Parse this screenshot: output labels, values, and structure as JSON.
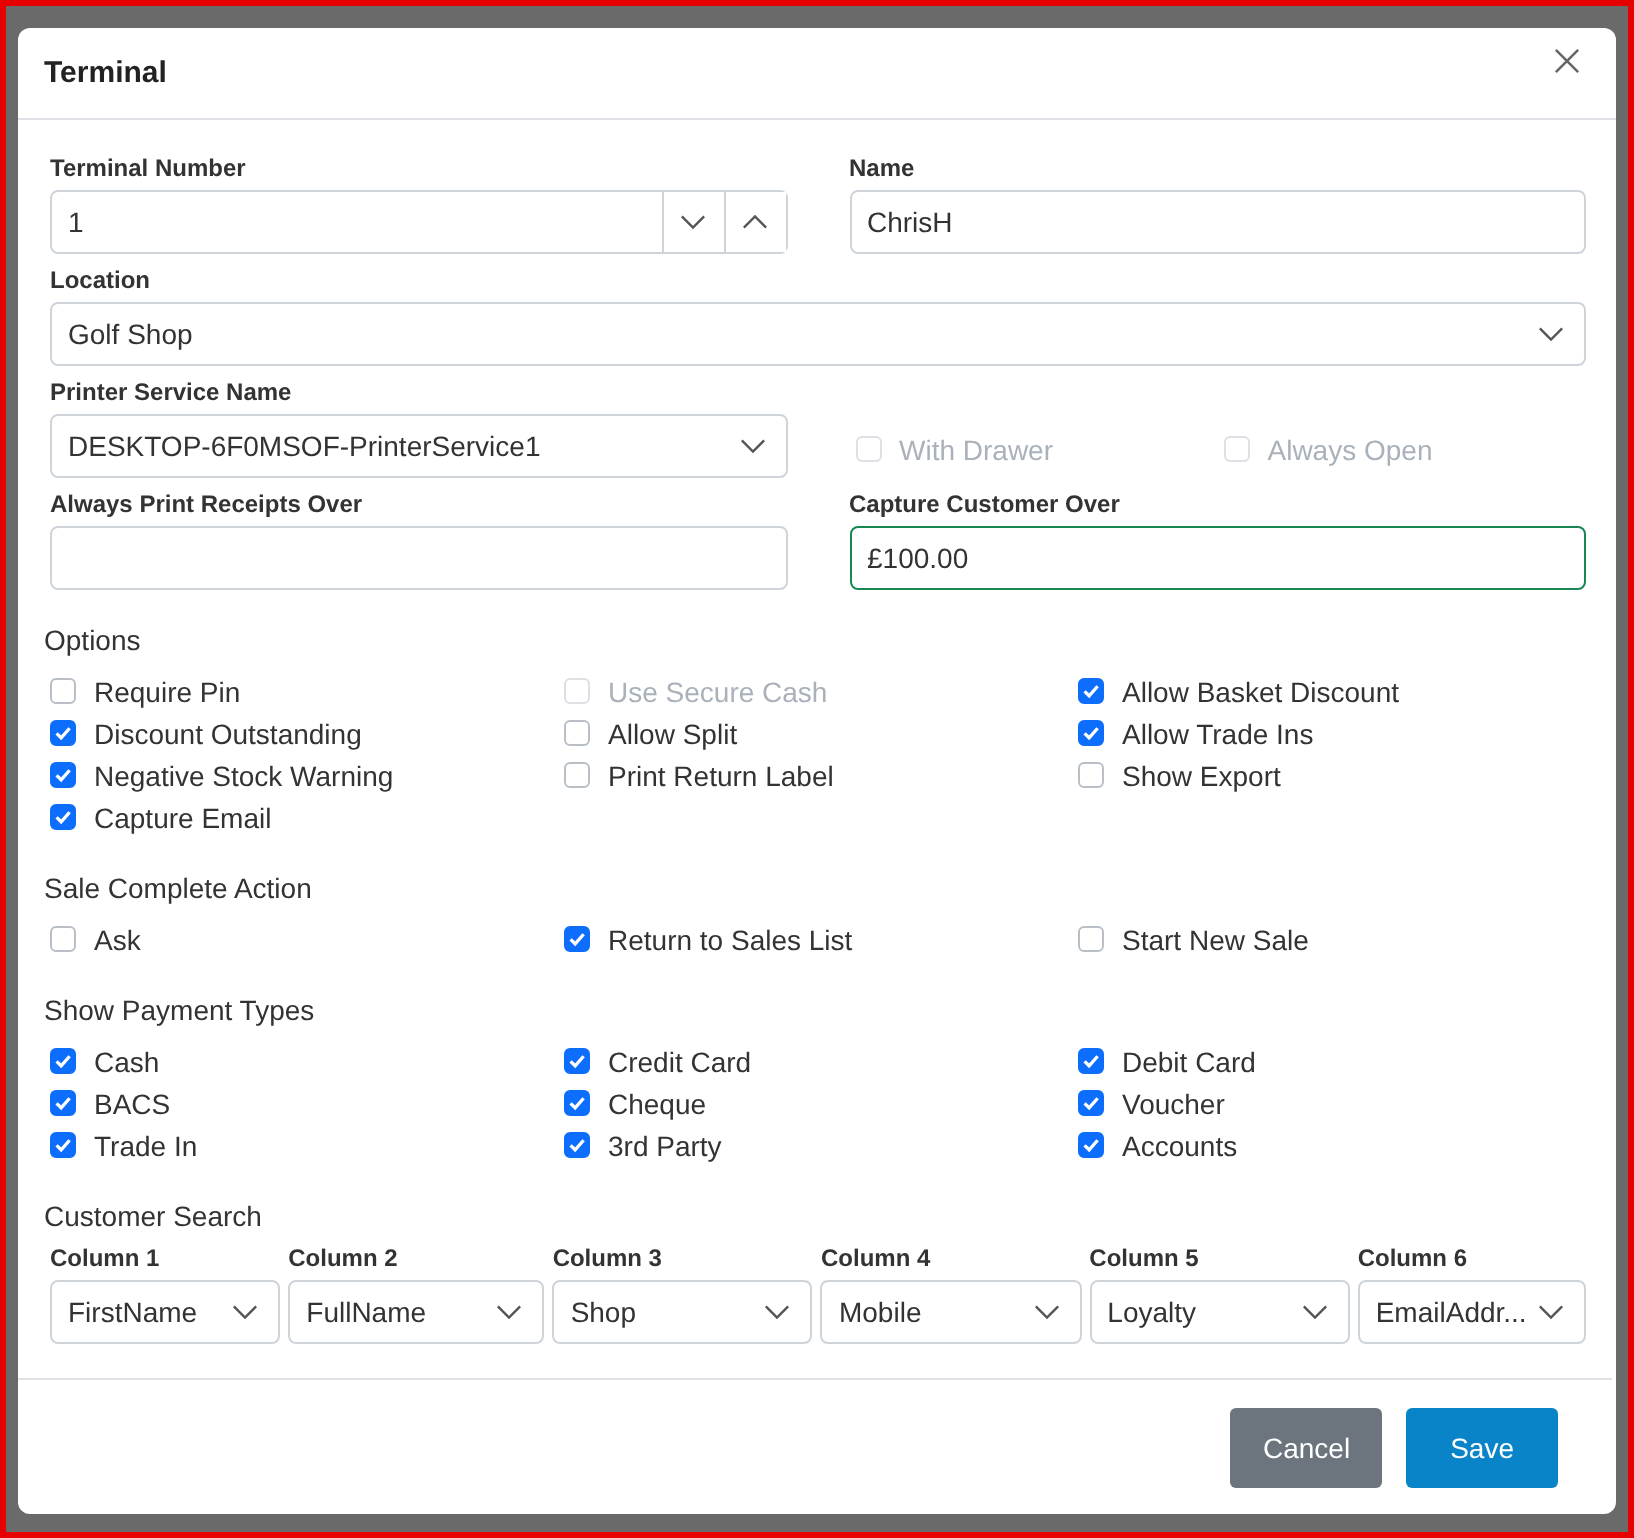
{
  "dialog": {
    "title": "Terminal"
  },
  "terminal_number": {
    "label": "Terminal Number",
    "value": "1"
  },
  "name": {
    "label": "Name",
    "value": "ChrisH",
    "focused": false
  },
  "location": {
    "label": "Location",
    "value": "Golf Shop"
  },
  "printer_service_name": {
    "label": "Printer Service Name",
    "value": "DESKTOP-6F0MSOF-PrinterService1"
  },
  "printer_options": [
    {
      "label": "With Drawer",
      "checked": false,
      "disabled": true
    },
    {
      "label": "Always Open",
      "checked": false,
      "disabled": true
    }
  ],
  "always_print_receipts_over": {
    "label": "Always Print Receipts Over",
    "focused": false
  },
  "capture_customer_over": {
    "label": "Capture Customer Over",
    "value": "£100.00",
    "focused": true
  },
  "sections": [
    {
      "title": "Options",
      "items": [
        {
          "label": "Require Pin",
          "checked": false,
          "disabled": false
        },
        {
          "label": "Use Secure Cash",
          "checked": false,
          "disabled": true
        },
        {
          "label": "Allow Basket Discount",
          "checked": true,
          "disabled": false
        },
        {
          "label": "Discount Outstanding",
          "checked": true,
          "disabled": false
        },
        {
          "label": "Allow Split",
          "checked": false,
          "disabled": false
        },
        {
          "label": "Allow Trade Ins",
          "checked": true,
          "disabled": false
        },
        {
          "label": "Negative Stock Warning",
          "checked": true,
          "disabled": false
        },
        {
          "label": "Print Return Label",
          "checked": false,
          "disabled": false
        },
        {
          "label": "Show Export",
          "checked": false,
          "disabled": false
        },
        {
          "label": "Capture Email",
          "checked": true,
          "disabled": false
        }
      ]
    },
    {
      "title": "Sale Complete Action",
      "items": [
        {
          "label": "Ask",
          "checked": false,
          "disabled": false
        },
        {
          "label": "Return to Sales List",
          "checked": true,
          "disabled": false
        },
        {
          "label": "Start New Sale",
          "checked": false,
          "disabled": false
        }
      ]
    },
    {
      "title": "Show Payment Types",
      "items": [
        {
          "label": "Cash",
          "checked": true,
          "disabled": false
        },
        {
          "label": "Credit Card",
          "checked": true,
          "disabled": false
        },
        {
          "label": "Debit Card",
          "checked": true,
          "disabled": false
        },
        {
          "label": "BACS",
          "checked": true,
          "disabled": false
        },
        {
          "label": "Cheque",
          "checked": true,
          "disabled": false
        },
        {
          "label": "Voucher",
          "checked": true,
          "disabled": false
        },
        {
          "label": "Trade In",
          "checked": true,
          "disabled": false
        },
        {
          "label": "3rd Party",
          "checked": true,
          "disabled": false
        },
        {
          "label": "Accounts",
          "checked": true,
          "disabled": false
        }
      ]
    }
  ],
  "customer_search": {
    "title": "Customer Search",
    "columns": [
      {
        "label": "Column 1",
        "value": "FirstName"
      },
      {
        "label": "Column 2",
        "value": "FullName"
      },
      {
        "label": "Column 3",
        "value": "Shop"
      },
      {
        "label": "Column 4",
        "value": "Mobile"
      },
      {
        "label": "Column 5",
        "value": "Loyalty"
      },
      {
        "label": "Column 6",
        "value": "EmailAddr..."
      }
    ]
  },
  "buttons": [
    {
      "label": "Cancel",
      "kind": "secondary"
    },
    {
      "label": "Save",
      "kind": "primary"
    }
  ]
}
